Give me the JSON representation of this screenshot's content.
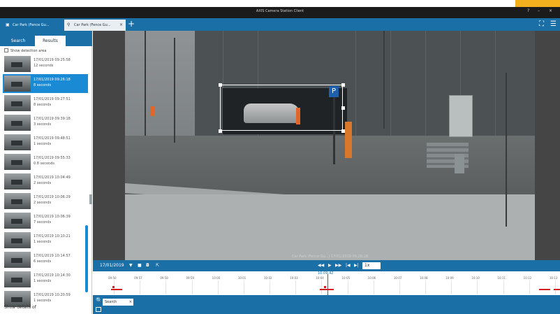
{
  "window": {
    "title": "AXIS Camera Station Client",
    "controls": [
      "?",
      "–",
      "×"
    ]
  },
  "colors": {
    "accent": "#1a6fa6",
    "selected": "#1a8ad4",
    "event": "#d61f1f",
    "highlight": "#f2b01e"
  },
  "tabs": [
    {
      "label": "Car Park (Fence Gu...",
      "icon": "camera-icon"
    },
    {
      "label": "Car Park (Fence Gu...",
      "icon": "search-icon",
      "close": "×"
    }
  ],
  "tab_add": "+",
  "toolbar_right": {
    "fullscreen": "⛶",
    "menu": "☰"
  },
  "sidebar": {
    "tabs": [
      "Search",
      "Results"
    ],
    "show_detection_area": "Show detection area",
    "results": [
      {
        "date": "17/01/2019 09:25:58",
        "duration": "12 seconds",
        "selected": false
      },
      {
        "date": "17/01/2019 09:26:18",
        "duration": "8 seconds",
        "selected": true
      },
      {
        "date": "17/01/2019 09:27:51",
        "duration": "8 seconds",
        "selected": false
      },
      {
        "date": "17/01/2019 09:39:18",
        "duration": "3 seconds",
        "selected": false
      },
      {
        "date": "17/01/2019 09:48:51",
        "duration": "1 seconds",
        "selected": false
      },
      {
        "date": "17/01/2019 09:55:33",
        "duration": "0.8 seconds",
        "selected": false
      },
      {
        "date": "17/01/2019 10:04:49",
        "duration": "2 seconds",
        "selected": false
      },
      {
        "date": "17/01/2019 10:06:29",
        "duration": "2 seconds",
        "selected": false
      },
      {
        "date": "17/01/2019 10:06:39",
        "duration": "7 seconds",
        "selected": false
      },
      {
        "date": "17/01/2019 10:10:21",
        "duration": "1 seconds",
        "selected": false
      },
      {
        "date": "17/01/2019 10:14:57",
        "duration": "6 seconds",
        "selected": false
      },
      {
        "date": "17/01/2019 10:14:30",
        "duration": "1 seconds",
        "selected": false
      },
      {
        "date": "17/01/2019 10:20:59",
        "duration": "1 seconds",
        "selected": false
      }
    ],
    "footer": "Show details of"
  },
  "video": {
    "caption": "Car Park (Fence Gu...) 17/01/2019 09:26:18"
  },
  "controls": {
    "date": "17/01/2019",
    "filter_icon": "▼",
    "stop_icon": "■",
    "bookmark_icon": "◘",
    "export_icon": "⇱",
    "prev": "◀◀",
    "play": "▶",
    "next": "▶▶",
    "skip_back": "|◀",
    "skip_fwd": "▶|",
    "speed": "1x"
  },
  "timeline": {
    "current_time": "10:09:42",
    "ticks": [
      "09:50",
      "09:57",
      "09:58",
      "09:59",
      "10:00",
      "10:01",
      "10:02",
      "10:03",
      "10:04",
      "10:05",
      "10:06",
      "10:07",
      "10:08",
      "10:09",
      "10:10",
      "10:11",
      "10:12",
      "10:13"
    ]
  },
  "bottom": {
    "search_placeholder": "Search",
    "clear": "×",
    "search_icon": "🔍"
  }
}
